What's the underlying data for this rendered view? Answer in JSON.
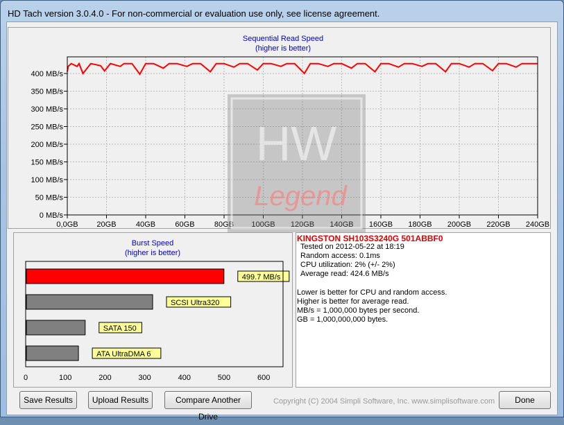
{
  "window": {
    "title": "HD Tach version 3.0.4.0  - For non-commercial or evaluation use only, see license agreement."
  },
  "seq_chart": {
    "title": "Sequential Read Speed",
    "subtitle": "(higher is better)",
    "y_ticks": [
      "0 MB/s",
      "50 MB/s",
      "100 MB/s",
      "150 MB/s",
      "200 MB/s",
      "250 MB/s",
      "300 MB/s",
      "350 MB/s",
      "400 MB/s"
    ],
    "x_ticks": [
      "0,0GB",
      "20GB",
      "40GB",
      "60GB",
      "80GB",
      "100GB",
      "120GB",
      "140GB",
      "160GB",
      "180GB",
      "200GB",
      "220GB",
      "240GB"
    ],
    "line_color": "#ff0000"
  },
  "burst_chart": {
    "title": "Burst Speed",
    "subtitle": "(higher is better)",
    "x_ticks": [
      "0",
      "100",
      "200",
      "300",
      "400",
      "500",
      "600"
    ],
    "bars": [
      {
        "label": "499.7 MB/s",
        "value": 499.7,
        "color": "#ff0000"
      },
      {
        "label": "SCSI Ultra320",
        "value": 320,
        "color": "#808080"
      },
      {
        "label": "SATA 150",
        "value": 150,
        "color": "#808080"
      },
      {
        "label": "ATA UltraDMA 6",
        "value": 133,
        "color": "#808080"
      }
    ]
  },
  "chart_data": [
    {
      "type": "line",
      "title": "Sequential Read Speed",
      "subtitle": "(higher is better)",
      "xlim": [
        0,
        240
      ],
      "ylim": [
        0,
        400
      ],
      "x_tick_labels": [
        "0,0GB",
        "20GB",
        "40GB",
        "60GB",
        "80GB",
        "100GB",
        "120GB",
        "140GB",
        "160GB",
        "180GB",
        "200GB",
        "220GB",
        "240GB"
      ],
      "y_tick_labels": [
        "0 MB/s",
        "50 MB/s",
        "100 MB/s",
        "150 MB/s",
        "200 MB/s",
        "250 MB/s",
        "300 MB/s",
        "350 MB/s",
        "400 MB/s"
      ],
      "series": [
        {
          "x": [
            0,
            0.5,
            2,
            5,
            6,
            8,
            12,
            17,
            19,
            22,
            27,
            29,
            33,
            37,
            40,
            44,
            49,
            52,
            56,
            61,
            64,
            68,
            73,
            76,
            80,
            85,
            88,
            92,
            97,
            100,
            104,
            109,
            112,
            116,
            121,
            124,
            128,
            133,
            136,
            140,
            145,
            148,
            152,
            157,
            160,
            164,
            169,
            172,
            176,
            181,
            184,
            188,
            193,
            196,
            200,
            205,
            208,
            212,
            217,
            220,
            224,
            229,
            232,
            236,
            240
          ],
          "y": [
            405,
            420,
            428,
            420,
            428,
            400,
            428,
            422,
            407,
            428,
            420,
            428,
            428,
            398,
            428,
            428,
            415,
            428,
            428,
            420,
            428,
            428,
            405,
            428,
            428,
            418,
            428,
            428,
            410,
            428,
            428,
            420,
            428,
            428,
            400,
            428,
            428,
            420,
            428,
            428,
            415,
            428,
            428,
            405,
            428,
            428,
            418,
            428,
            428,
            420,
            428,
            428,
            405,
            428,
            428,
            418,
            428,
            428,
            408,
            428,
            428,
            418,
            428,
            428,
            428
          ]
        }
      ]
    },
    {
      "type": "bar",
      "title": "Burst Speed",
      "subtitle": "(higher is better)",
      "orientation": "horizontal",
      "categories": [
        "499.7 MB/s",
        "SCSI Ultra320",
        "SATA 150",
        "ATA UltraDMA 6"
      ],
      "values": [
        499.7,
        320,
        150,
        133
      ],
      "xlim": [
        0,
        600
      ],
      "x_tick_labels": [
        "0",
        "100",
        "200",
        "300",
        "400",
        "500",
        "600"
      ]
    }
  ],
  "info": {
    "drive_name": "KINGSTON SH103S3240G 501ABBF0",
    "tested_on": "Tested on 2012-05-22 at 18:19",
    "random_access": "Random access: 0.1ms",
    "cpu": "CPU utilization: 2% (+/- 2%)",
    "avg_read": "Average read: 424.6 MB/s",
    "note1": "Lower is better for CPU and random access.",
    "note2": "Higher is better for average read.",
    "note3": "MB/s = 1,000,000 bytes per second.",
    "note4": "GB = 1,000,000,000 bytes."
  },
  "buttons": {
    "save": "Save Results",
    "upload": "Upload Results",
    "compare": "Compare Another Drive",
    "done": "Done"
  },
  "copyright": "Copyright (C) 2004 Simpli Software, Inc. www.simplisoftware.com",
  "watermark": {
    "text_top": "HW",
    "text_bottom": "Legend"
  }
}
